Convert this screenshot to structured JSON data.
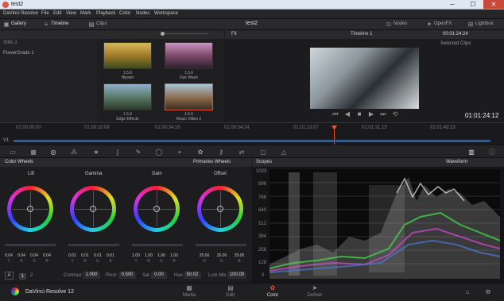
{
  "window": {
    "title": "test2",
    "min": "─",
    "max": "☐",
    "close": "✕"
  },
  "menu": [
    "DaVinci Resolve",
    "File",
    "Edit",
    "View",
    "Mark",
    "Playback",
    "Color",
    "Nodes",
    "Workspace"
  ],
  "topbar": {
    "gallery": "Gallery",
    "timeline": "Timeline",
    "clips": "Clips",
    "project": "test2",
    "nodes": "Nodes",
    "openfx": "OpenFX",
    "lightbox": "Lightbox"
  },
  "gallery": {
    "still": "Stills 1",
    "grade": "PowerGrade 1",
    "items": [
      {
        "num": "1.5.6",
        "name": "Hipster"
      },
      {
        "num": "1.5.6",
        "name": "Dye Wash"
      },
      {
        "num": "1.5.6",
        "name": "Edge Effects"
      },
      {
        "num": "1.5.6",
        "name": "Music Video 2"
      }
    ]
  },
  "viewer": {
    "fit": "Fit",
    "timeline_name": "Timeline 1",
    "timecode_top": "00:01:24:24",
    "selected": "Selected Clips",
    "timecode": "01:01:24:12"
  },
  "ruler": [
    "01:00:00:00",
    "01:00:10:08",
    "01:00:34:16",
    "01:00:54:24",
    "01:01:13:07",
    "01:01:31:15",
    "01:01:49:23"
  ],
  "track_label": "V1",
  "color_wheels": {
    "title": "Color Wheels",
    "mode": "Primaries Wheels",
    "wheels": [
      {
        "name": "Lift",
        "values": [
          "0.04",
          "0.04",
          "0.04",
          "0.04"
        ],
        "channels": [
          "Y",
          "R",
          "G",
          "B"
        ]
      },
      {
        "name": "Gamma",
        "values": [
          "0.01",
          "0.01",
          "0.01",
          "0.01"
        ],
        "channels": [
          "Y",
          "R",
          "G",
          "B"
        ]
      },
      {
        "name": "Gain",
        "values": [
          "1.00",
          "1.00",
          "1.00",
          "1.00"
        ],
        "channels": [
          "Y",
          "R",
          "G",
          "B"
        ]
      },
      {
        "name": "Offset",
        "values": [
          "25.00",
          "25.00",
          "25.00"
        ],
        "channels": [
          "R",
          "G",
          "B"
        ]
      }
    ]
  },
  "bottom_controls": {
    "a": "A",
    "p1": "1",
    "p2": "2",
    "contrast_label": "Contrast",
    "contrast": "1.000",
    "pivot_label": "Pivot",
    "pivot": "0.500",
    "sat_label": "Sat",
    "sat": "0.00",
    "hue_label": "Hue",
    "hue": "50.02",
    "lummix_label": "Lum Mix",
    "lummix": "100.00"
  },
  "scopes": {
    "title": "Scopes",
    "mode": "Waveform",
    "ticks": [
      "1023",
      "896",
      "768",
      "640",
      "512",
      "384",
      "256",
      "128",
      "0"
    ]
  },
  "pages": {
    "app": "DaVinci Resolve 12",
    "items": [
      "Media",
      "Edit",
      "Color",
      "Deliver"
    ]
  },
  "colors": {
    "accent": "#e8512a",
    "bg": "#1b1b1d",
    "panel": "#26262a"
  }
}
